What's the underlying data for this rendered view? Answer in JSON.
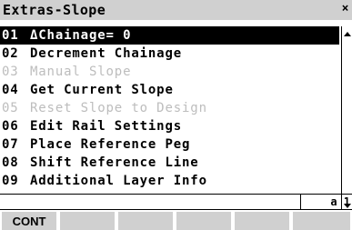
{
  "window": {
    "title": "Extras-Slope",
    "close_glyph": "×"
  },
  "menu": {
    "items": [
      {
        "number": "01",
        "label": "ΔChainage= 0",
        "state": "selected"
      },
      {
        "number": "02",
        "label": "Decrement Chainage",
        "state": "enabled"
      },
      {
        "number": "03",
        "label": "Manual Slope",
        "state": "disabled"
      },
      {
        "number": "04",
        "label": "Get Current Slope",
        "state": "enabled"
      },
      {
        "number": "05",
        "label": "Reset Slope to Design",
        "state": "disabled"
      },
      {
        "number": "06",
        "label": "Edit Rail Settings",
        "state": "enabled"
      },
      {
        "number": "07",
        "label": "Place Reference Peg",
        "state": "enabled"
      },
      {
        "number": "08",
        "label": "Shift Reference Line",
        "state": "enabled"
      },
      {
        "number": "09",
        "label": "Additional Layer Info",
        "state": "enabled"
      }
    ]
  },
  "scrollbar": {
    "up_icon": "arrow-up-icon",
    "down_icon": "arrow-down-icon"
  },
  "status": {
    "input_mode": "a 1"
  },
  "function_keys": [
    {
      "label": "CONT"
    },
    {
      "label": ""
    },
    {
      "label": ""
    },
    {
      "label": ""
    },
    {
      "label": ""
    },
    {
      "label": ""
    }
  ],
  "colors": {
    "title_background": "#d0d0d0",
    "selected_background": "#000000",
    "selected_text": "#ffffff",
    "disabled_text": "#bdbdbd",
    "function_key_background": "#d0d0d0"
  }
}
